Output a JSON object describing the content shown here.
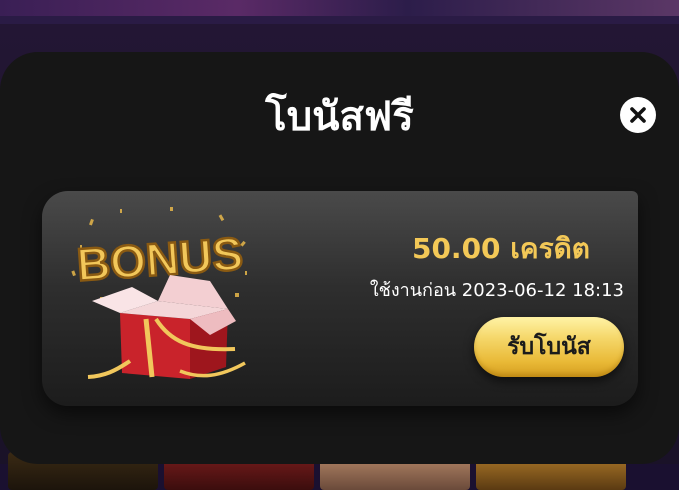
{
  "modal": {
    "title": "โบนัสฟรี",
    "close_icon": "close-icon"
  },
  "bonus_card": {
    "image_label": "BONUS",
    "image_icon": "gift-box-icon",
    "amount": "50.00 เครดิต",
    "expiry": "ใช้งานก่อน 2023-06-12 18:13",
    "claim_label": "รับโบนัส"
  },
  "colors": {
    "amount": "#f3c857",
    "claim_button": "#f5d76a",
    "modal_bg": "#161616"
  }
}
